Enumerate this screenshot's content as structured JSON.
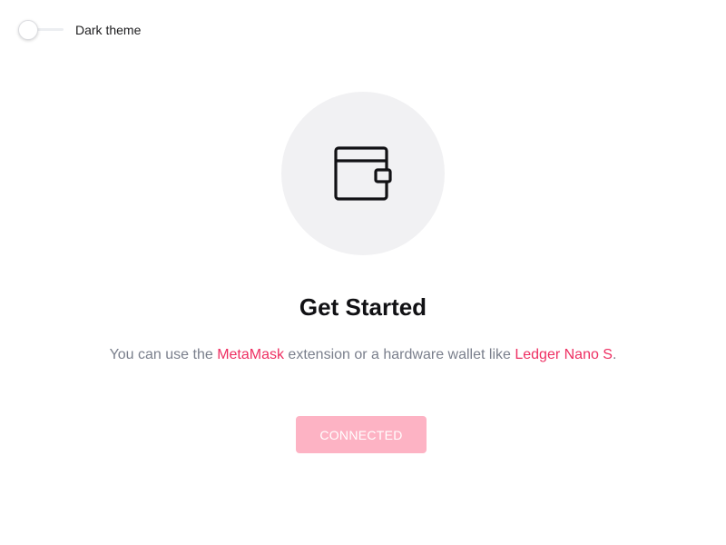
{
  "theme_toggle": {
    "label": "Dark theme",
    "enabled": false
  },
  "illustration": {
    "icon": "wallet-icon"
  },
  "title": "Get Started",
  "description": {
    "prefix": "You can use the ",
    "metamask_link": "MetaMask",
    "middle": " extension or a hardware wallet like ",
    "ledger_link": "Ledger Nano S",
    "suffix": "."
  },
  "connect_button": {
    "label": "CONNECTED",
    "disabled": true
  },
  "colors": {
    "accent": "#ee2f62",
    "button_bg": "#fdb3c4",
    "circle_bg": "#f1f1f3",
    "text_muted": "#7a7f8c",
    "text_dark": "#111114"
  }
}
